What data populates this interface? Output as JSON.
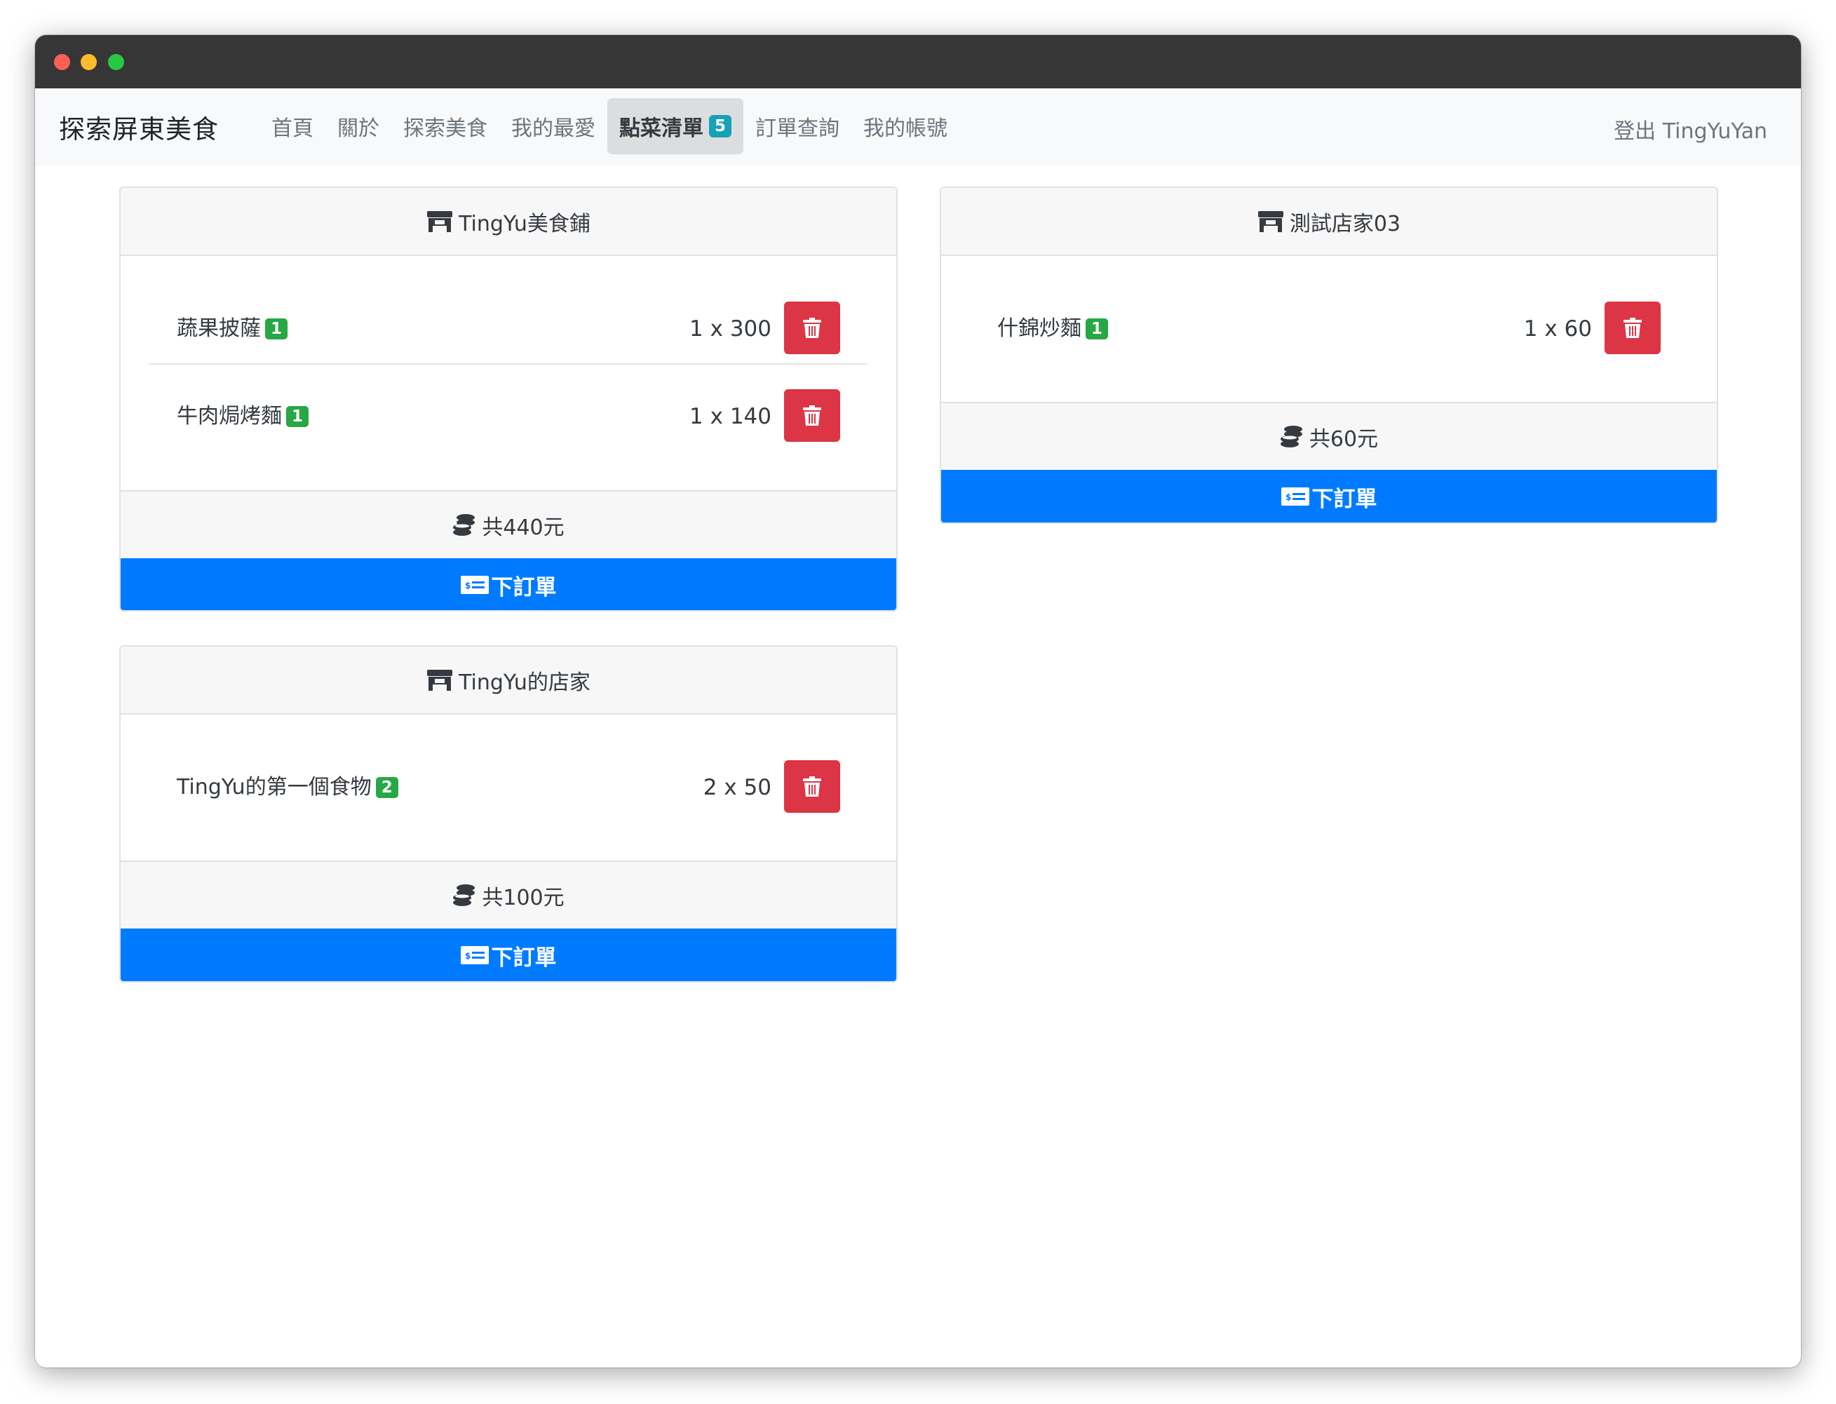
{
  "navbar": {
    "brand": "探索屏東美食",
    "items": [
      {
        "label": "首頁"
      },
      {
        "label": "關於"
      },
      {
        "label": "探索美食"
      },
      {
        "label": "我的最愛"
      },
      {
        "label": "點菜清單",
        "badge": "5"
      },
      {
        "label": "訂單查詢"
      },
      {
        "label": "我的帳號"
      }
    ],
    "logout": "登出 TingYuYan"
  },
  "stores": [
    {
      "name": "TingYu美食鋪",
      "items": [
        {
          "name": "蔬果披薩",
          "qty": "1",
          "price": "1 x 300"
        },
        {
          "name": "牛肉焗烤麵",
          "qty": "1",
          "price": "1 x 140"
        }
      ],
      "total": "共440元",
      "order_label": "下訂單"
    },
    {
      "name": "測試店家03",
      "items": [
        {
          "name": "什錦炒麵",
          "qty": "1",
          "price": "1 x 60"
        }
      ],
      "total": "共60元",
      "order_label": "下訂單"
    },
    {
      "name": "TingYu的店家",
      "items": [
        {
          "name": "TingYu的第一個食物",
          "qty": "2",
          "price": "2 x 50"
        }
      ],
      "total": "共100元",
      "order_label": "下訂單"
    }
  ],
  "icons": {
    "store": "store-icon",
    "coins": "coins-icon",
    "bill": "money-bill-icon",
    "delete": "trash-icon"
  },
  "colors": {
    "primary": "#007bff",
    "danger": "#dc3545",
    "success": "#28a745",
    "info": "#17a2b8"
  }
}
